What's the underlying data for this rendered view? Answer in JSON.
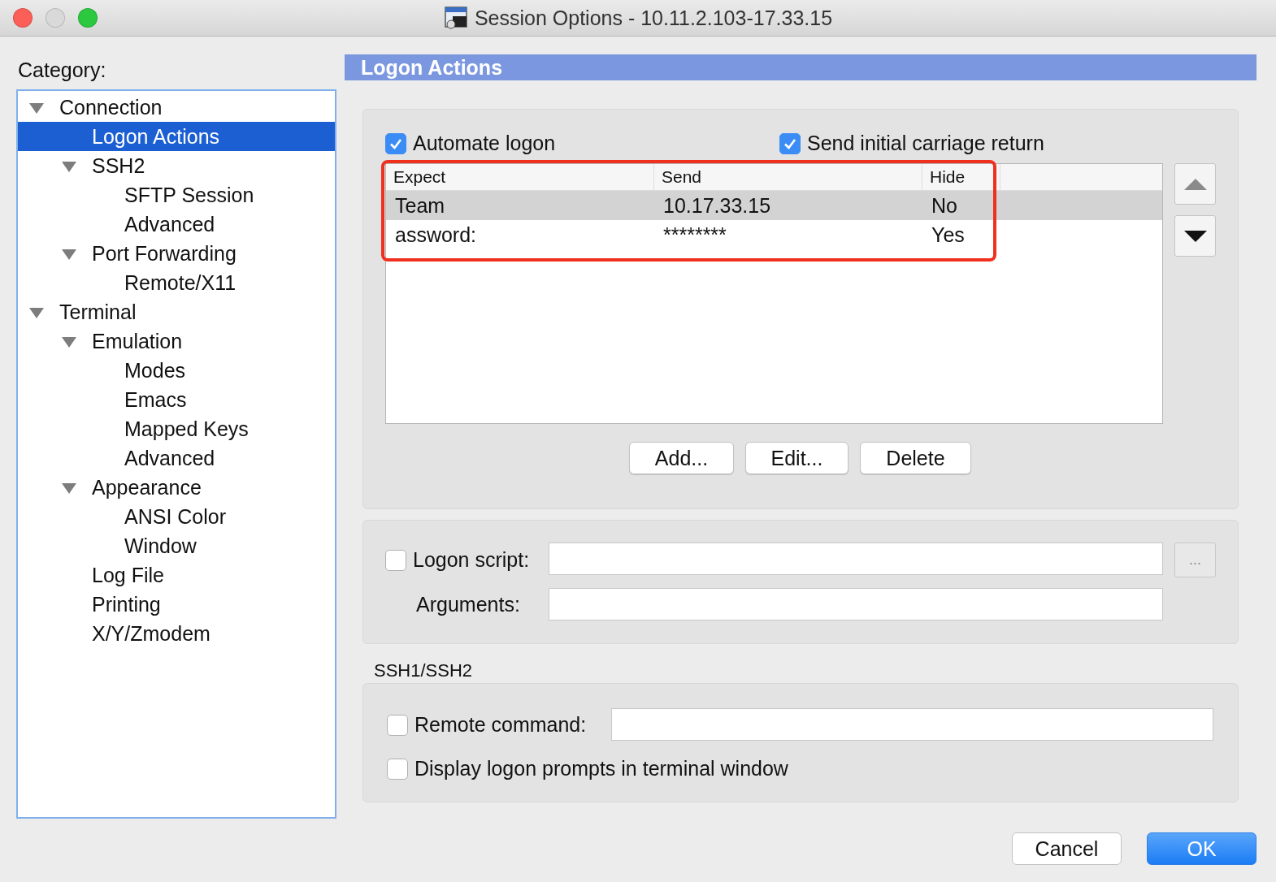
{
  "window": {
    "title": "Session Options - 10.11.2.103-17.33.15"
  },
  "category": {
    "label": "Category:",
    "tree": [
      {
        "label": "Connection",
        "expanded": true,
        "selected": false,
        "children": [
          {
            "label": "Logon Actions",
            "selected": true
          },
          {
            "label": "SSH2",
            "expanded": true,
            "selected": false,
            "children": [
              {
                "label": "SFTP Session",
                "selected": false
              },
              {
                "label": "Advanced",
                "selected": false
              }
            ]
          },
          {
            "label": "Port Forwarding",
            "expanded": true,
            "selected": false,
            "children": [
              {
                "label": "Remote/X11",
                "selected": false
              }
            ]
          }
        ]
      },
      {
        "label": "Terminal",
        "expanded": true,
        "selected": false,
        "children": [
          {
            "label": "Emulation",
            "expanded": true,
            "selected": false,
            "children": [
              {
                "label": "Modes",
                "selected": false
              },
              {
                "label": "Emacs",
                "selected": false
              },
              {
                "label": "Mapped Keys",
                "selected": false
              },
              {
                "label": "Advanced",
                "selected": false
              }
            ]
          },
          {
            "label": "Appearance",
            "expanded": true,
            "selected": false,
            "children": [
              {
                "label": "ANSI Color",
                "selected": false
              },
              {
                "label": "Window",
                "selected": false
              }
            ]
          },
          {
            "label": "Log File",
            "selected": false
          },
          {
            "label": "Printing",
            "selected": false
          },
          {
            "label": "X/Y/Zmodem",
            "selected": false
          }
        ]
      }
    ]
  },
  "panel": {
    "title": "Logon Actions",
    "options": [
      {
        "label": "Automate logon",
        "checked": true
      },
      {
        "label": "Send initial carriage return",
        "checked": true
      }
    ],
    "table": {
      "columns": [
        "Expect",
        "Send",
        "Hide"
      ],
      "rows": [
        {
          "cells": [
            "Team",
            "10.17.33.15",
            "No"
          ],
          "selected": true
        },
        {
          "cells": [
            "assword:",
            "********",
            "Yes"
          ],
          "selected": false
        }
      ]
    },
    "buttons": [
      "Add...",
      "Edit...",
      "Delete"
    ],
    "logon_script": {
      "label": "Logon script:",
      "checked": false,
      "browse": "..."
    },
    "arguments": {
      "label": "Arguments:"
    },
    "ssh_section": {
      "title": "SSH1/SSH2",
      "remote_command": {
        "label": "Remote command:",
        "checked": false
      },
      "display_prompts": {
        "label": "Display logon prompts in terminal window",
        "checked": false
      }
    }
  },
  "dialog_buttons": [
    {
      "label": "Cancel",
      "default": false
    },
    {
      "label": "OK",
      "default": true
    }
  ]
}
